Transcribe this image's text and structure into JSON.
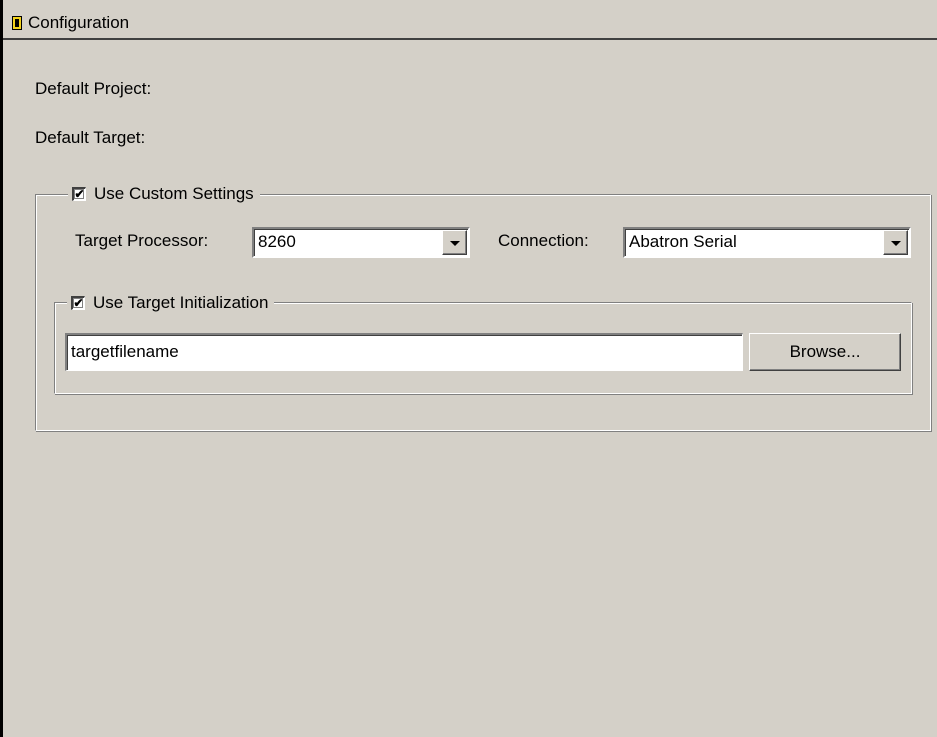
{
  "window": {
    "title": "Configuration",
    "icon": "app-icon"
  },
  "labels": {
    "default_project": "Default Project:",
    "default_target": "Default Target:"
  },
  "custom_settings": {
    "label": "Use Custom Settings",
    "checked": true,
    "target_processor_label": "Target Processor:",
    "target_processor_value": "8260",
    "connection_label": "Connection:",
    "connection_value": "Abatron Serial"
  },
  "target_init": {
    "label": "Use Target Initialization",
    "checked": true,
    "filename": "targetfilename",
    "browse_label": "Browse..."
  },
  "colors": {
    "background": "#d4d0c8",
    "icon_accent": "#f2d21c"
  }
}
